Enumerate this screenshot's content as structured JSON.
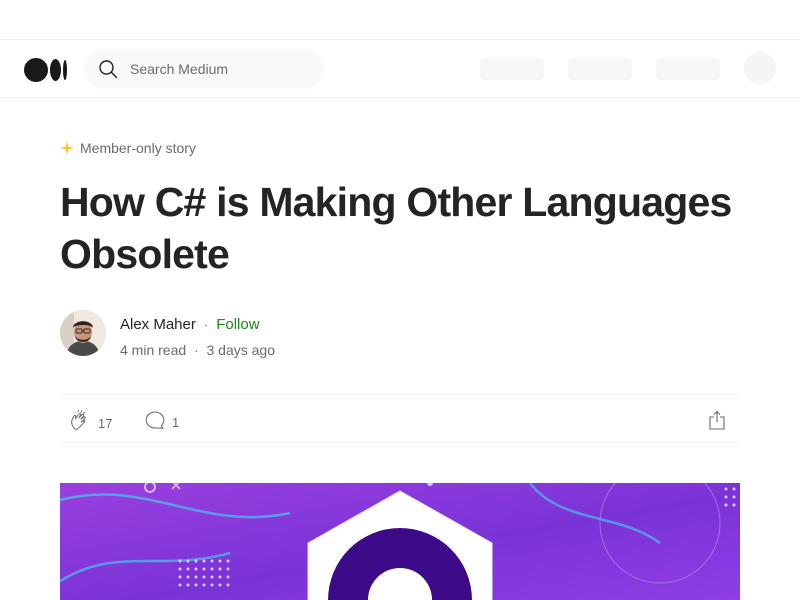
{
  "header": {
    "search_placeholder": "Search Medium"
  },
  "article": {
    "badge": "Member-only story",
    "title": "How C# is Making Other Languages Obsolete",
    "author": {
      "name": "Alex Maher",
      "follow_label": "Follow",
      "read_time": "4 min read",
      "published": "3 days ago",
      "separator": "·"
    },
    "actions": {
      "claps": "17",
      "responses": "1"
    }
  },
  "colors": {
    "accent_green": "#1a8917",
    "star_gold": "#ffc017",
    "hero_purple": "#8b3fd9"
  }
}
